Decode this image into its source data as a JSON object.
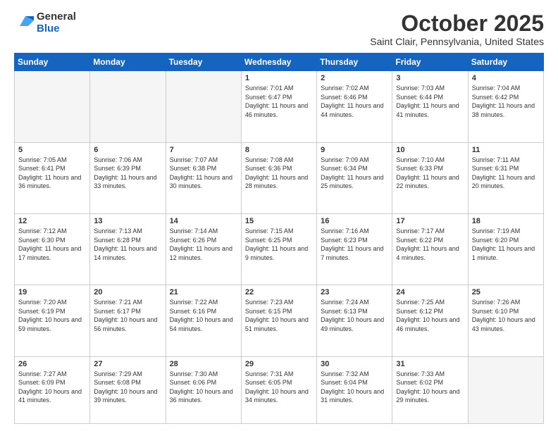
{
  "logo": {
    "general": "General",
    "blue": "Blue"
  },
  "header": {
    "month": "October 2025",
    "location": "Saint Clair, Pennsylvania, United States"
  },
  "days_of_week": [
    "Sunday",
    "Monday",
    "Tuesday",
    "Wednesday",
    "Thursday",
    "Friday",
    "Saturday"
  ],
  "weeks": [
    [
      {
        "day": "",
        "empty": true
      },
      {
        "day": "",
        "empty": true
      },
      {
        "day": "",
        "empty": true
      },
      {
        "day": "1",
        "sunrise": "7:01 AM",
        "sunset": "6:47 PM",
        "daylight": "11 hours and 46 minutes."
      },
      {
        "day": "2",
        "sunrise": "7:02 AM",
        "sunset": "6:46 PM",
        "daylight": "11 hours and 44 minutes."
      },
      {
        "day": "3",
        "sunrise": "7:03 AM",
        "sunset": "6:44 PM",
        "daylight": "11 hours and 41 minutes."
      },
      {
        "day": "4",
        "sunrise": "7:04 AM",
        "sunset": "6:42 PM",
        "daylight": "11 hours and 38 minutes."
      }
    ],
    [
      {
        "day": "5",
        "sunrise": "7:05 AM",
        "sunset": "6:41 PM",
        "daylight": "11 hours and 36 minutes."
      },
      {
        "day": "6",
        "sunrise": "7:06 AM",
        "sunset": "6:39 PM",
        "daylight": "11 hours and 33 minutes."
      },
      {
        "day": "7",
        "sunrise": "7:07 AM",
        "sunset": "6:38 PM",
        "daylight": "11 hours and 30 minutes."
      },
      {
        "day": "8",
        "sunrise": "7:08 AM",
        "sunset": "6:36 PM",
        "daylight": "11 hours and 28 minutes."
      },
      {
        "day": "9",
        "sunrise": "7:09 AM",
        "sunset": "6:34 PM",
        "daylight": "11 hours and 25 minutes."
      },
      {
        "day": "10",
        "sunrise": "7:10 AM",
        "sunset": "6:33 PM",
        "daylight": "11 hours and 22 minutes."
      },
      {
        "day": "11",
        "sunrise": "7:11 AM",
        "sunset": "6:31 PM",
        "daylight": "11 hours and 20 minutes."
      }
    ],
    [
      {
        "day": "12",
        "sunrise": "7:12 AM",
        "sunset": "6:30 PM",
        "daylight": "11 hours and 17 minutes."
      },
      {
        "day": "13",
        "sunrise": "7:13 AM",
        "sunset": "6:28 PM",
        "daylight": "11 hours and 14 minutes."
      },
      {
        "day": "14",
        "sunrise": "7:14 AM",
        "sunset": "6:26 PM",
        "daylight": "11 hours and 12 minutes."
      },
      {
        "day": "15",
        "sunrise": "7:15 AM",
        "sunset": "6:25 PM",
        "daylight": "11 hours and 9 minutes."
      },
      {
        "day": "16",
        "sunrise": "7:16 AM",
        "sunset": "6:23 PM",
        "daylight": "11 hours and 7 minutes."
      },
      {
        "day": "17",
        "sunrise": "7:17 AM",
        "sunset": "6:22 PM",
        "daylight": "11 hours and 4 minutes."
      },
      {
        "day": "18",
        "sunrise": "7:19 AM",
        "sunset": "6:20 PM",
        "daylight": "11 hours and 1 minute."
      }
    ],
    [
      {
        "day": "19",
        "sunrise": "7:20 AM",
        "sunset": "6:19 PM",
        "daylight": "10 hours and 59 minutes."
      },
      {
        "day": "20",
        "sunrise": "7:21 AM",
        "sunset": "6:17 PM",
        "daylight": "10 hours and 56 minutes."
      },
      {
        "day": "21",
        "sunrise": "7:22 AM",
        "sunset": "6:16 PM",
        "daylight": "10 hours and 54 minutes."
      },
      {
        "day": "22",
        "sunrise": "7:23 AM",
        "sunset": "6:15 PM",
        "daylight": "10 hours and 51 minutes."
      },
      {
        "day": "23",
        "sunrise": "7:24 AM",
        "sunset": "6:13 PM",
        "daylight": "10 hours and 49 minutes."
      },
      {
        "day": "24",
        "sunrise": "7:25 AM",
        "sunset": "6:12 PM",
        "daylight": "10 hours and 46 minutes."
      },
      {
        "day": "25",
        "sunrise": "7:26 AM",
        "sunset": "6:10 PM",
        "daylight": "10 hours and 43 minutes."
      }
    ],
    [
      {
        "day": "26",
        "sunrise": "7:27 AM",
        "sunset": "6:09 PM",
        "daylight": "10 hours and 41 minutes."
      },
      {
        "day": "27",
        "sunrise": "7:29 AM",
        "sunset": "6:08 PM",
        "daylight": "10 hours and 39 minutes."
      },
      {
        "day": "28",
        "sunrise": "7:30 AM",
        "sunset": "6:06 PM",
        "daylight": "10 hours and 36 minutes."
      },
      {
        "day": "29",
        "sunrise": "7:31 AM",
        "sunset": "6:05 PM",
        "daylight": "10 hours and 34 minutes."
      },
      {
        "day": "30",
        "sunrise": "7:32 AM",
        "sunset": "6:04 PM",
        "daylight": "10 hours and 31 minutes."
      },
      {
        "day": "31",
        "sunrise": "7:33 AM",
        "sunset": "6:02 PM",
        "daylight": "10 hours and 29 minutes."
      },
      {
        "day": "",
        "empty": true
      }
    ]
  ]
}
